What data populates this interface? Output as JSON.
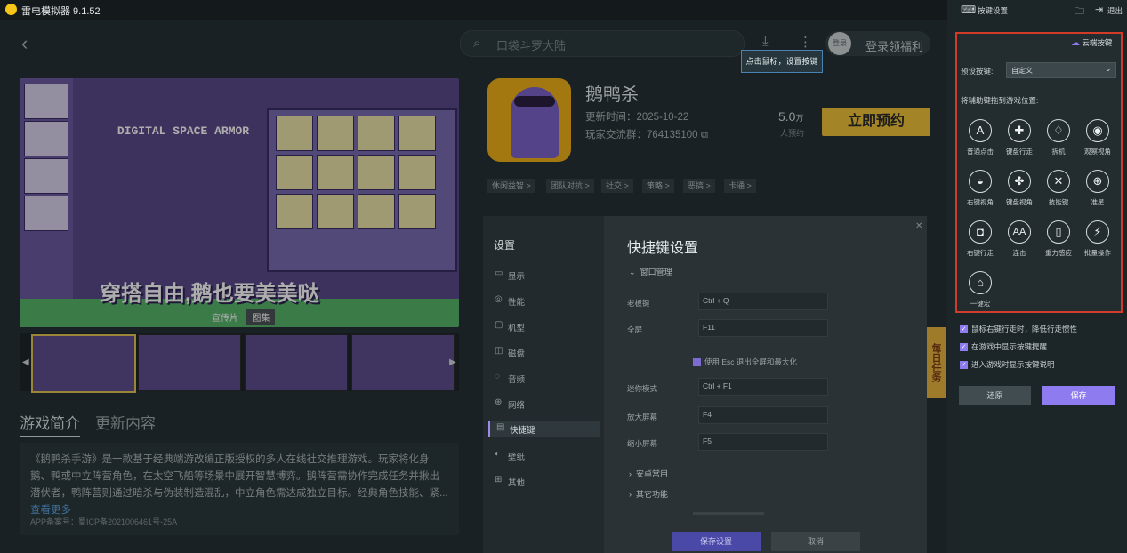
{
  "app": {
    "title": "雷电模拟器 9.1.52"
  },
  "top": {
    "search_placeholder": "口袋斗罗大陆",
    "avatar_text": "登录",
    "login_label": "登录领福利",
    "tooltip": "点击鼠标，设置按键"
  },
  "banner": {
    "title": "DIGITAL SPACE ARMOR",
    "slogan": "穿搭自由,鹅也要美美哒",
    "tab_promo": "宣传片",
    "tab_gallery": "图集"
  },
  "intro": {
    "tab_intro": "游戏简介",
    "tab_update": "更新内容",
    "text": "《鹅鸭杀手游》是一款基于经典端游改编正版授权的多人在线社交推理游戏。玩家将化身鹅、鸭或中立阵营角色，在太空飞船等场景中展开智慧博弈。鹅阵营需协作完成任务并揪出潜伏者，鸭阵营则通过暗杀与伪装制造混乱，中立角色需达成独立目标。经典角色技能、紧...",
    "more_link": "查看更多",
    "icp": "APP备案号：蜀ICP备2021006461号-25A"
  },
  "game": {
    "name": "鹅鸭杀",
    "update_time": "更新时间：2025-10-22",
    "group": "玩家交流群：764135100",
    "count": "5.0",
    "count_unit": "万",
    "count_sub": "人预约",
    "reserve_label": "立即预约",
    "tags": [
      "休闲益智 >",
      "团队对抗 >",
      "社交 >",
      "策略 >",
      "恶搞 >",
      "卡通 >"
    ]
  },
  "daily_tab": "每日任务",
  "settings": {
    "header": "设置",
    "nav": [
      {
        "icon": "▭",
        "label": "显示"
      },
      {
        "icon": "◎",
        "label": "性能"
      },
      {
        "icon": "▢",
        "label": "机型"
      },
      {
        "icon": "◫",
        "label": "磁盘"
      },
      {
        "icon": "◌",
        "label": "音频"
      },
      {
        "icon": "⊕",
        "label": "网络"
      },
      {
        "icon": "▤",
        "label": "快捷键"
      },
      {
        "icon": "◐",
        "label": "壁纸"
      },
      {
        "icon": "⊞",
        "label": "其他"
      }
    ],
    "title": "快捷键设置",
    "group_window": "窗口管理",
    "fields": [
      {
        "label": "老板键",
        "value": "Ctrl + Q"
      },
      {
        "label": "全屏",
        "value": "F11"
      },
      {
        "label": "迷你模式",
        "value": "Ctrl + F1"
      },
      {
        "label": "放大屏幕",
        "value": "F4"
      },
      {
        "label": "缩小屏幕",
        "value": "F5"
      }
    ],
    "esc_option": "使用 Esc 退出全屏和最大化",
    "group_android": "安卓常用",
    "group_other": "其它功能",
    "save_label": "保存设置",
    "cancel_label": "取消"
  },
  "keymap": {
    "title": "按键设置",
    "exit_label": "退出",
    "cloud_label": "云端按键",
    "preset_label": "预设按键:",
    "preset_value": "自定义",
    "drag_hint": "将辅助键拖到游戏位置:",
    "keys": [
      {
        "glyph": "A",
        "label": "普通点击"
      },
      {
        "glyph": "✚",
        "label": "键盘行走"
      },
      {
        "glyph": "♢",
        "label": "拆机"
      },
      {
        "glyph": "◉",
        "label": "观察视角"
      },
      {
        "glyph": "◒",
        "label": "右键视角"
      },
      {
        "glyph": "✤",
        "label": "键盘视角"
      },
      {
        "glyph": "✕",
        "label": "技能键"
      },
      {
        "glyph": "⊕",
        "label": "准星"
      },
      {
        "glyph": "◘",
        "label": "右键行走"
      },
      {
        "glyph": "AA",
        "label": "连击"
      },
      {
        "glyph": "▯",
        "label": "重力感应"
      },
      {
        "glyph": "⚡",
        "label": "批量操作"
      },
      {
        "glyph": "⌂",
        "label": "一键宏"
      }
    ],
    "options": [
      "鼠标右键行走时，降低行走惯性",
      "在游戏中显示按键提醒",
      "进入游戏时显示按键说明"
    ],
    "restore_label": "还原",
    "save_label": "保存"
  }
}
